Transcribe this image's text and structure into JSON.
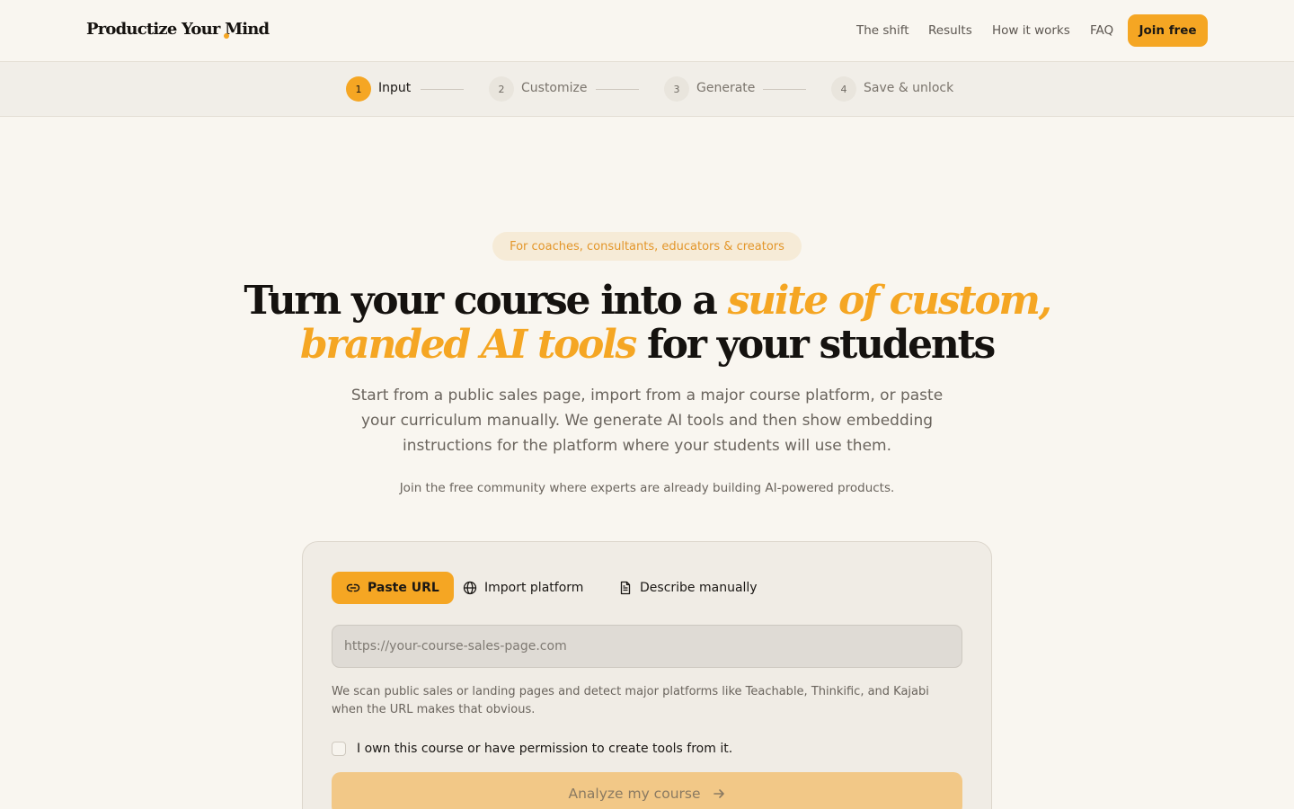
{
  "brand": {
    "name": "Productize Your Mind",
    "accent": "#f5a623"
  },
  "nav": {
    "links": [
      "The shift",
      "Results",
      "How it works",
      "FAQ"
    ],
    "cta": "Join free"
  },
  "stepper": {
    "steps": [
      {
        "number": "1",
        "label": "Input",
        "active": true
      },
      {
        "number": "2",
        "label": "Customize",
        "active": false
      },
      {
        "number": "3",
        "label": "Generate",
        "active": false
      },
      {
        "number": "4",
        "label": "Save & unlock",
        "active": false
      }
    ]
  },
  "hero": {
    "pill": "For coaches, consultants, educators & creators",
    "headline": {
      "part1": "Turn your course into a ",
      "accent1": "suite of custom,",
      "accent2": "branded AI tools",
      "part2": " for your students"
    },
    "subhead": "Start from a public sales page, import from a major course platform, or paste your curriculum manually. We generate AI tools and then show embedding instructions for the platform where your students will use them.",
    "community": "Join the free community where experts are already building AI-powered products."
  },
  "form": {
    "tabs": [
      {
        "label": "Paste URL",
        "icon": "link-icon",
        "active": true
      },
      {
        "label": "Import platform",
        "icon": "globe-icon",
        "active": false
      },
      {
        "label": "Describe manually",
        "icon": "document-icon",
        "active": false
      }
    ],
    "url_placeholder": "https://your-course-sales-page.com",
    "url_value": "",
    "helper": "We scan public sales or landing pages and detect major platforms like Teachable, Thinkific, and Kajabi when the URL makes that obvious.",
    "permission_label": "I own this course or have permission to create tools from it.",
    "permission_checked": false,
    "submit_label": "Analyze my course"
  }
}
